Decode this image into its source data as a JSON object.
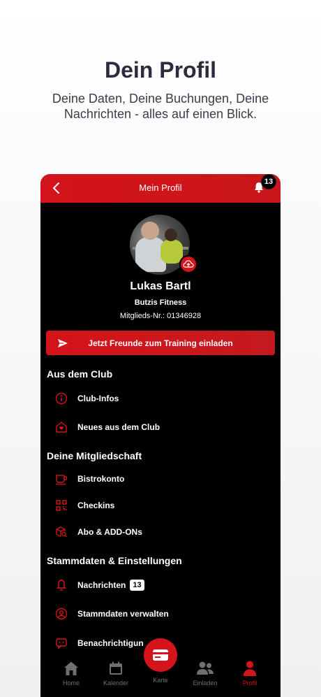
{
  "promo": {
    "title": "Dein Profil",
    "subtitle": "Deine Daten, Deine Buchungen, Deine Nachrichten - alles auf einen Blick."
  },
  "header": {
    "title": "Mein Profil",
    "notification_count": "13"
  },
  "profile": {
    "name": "Lukas Bartl",
    "club": "Butzis Fitness",
    "member_number": "Mitglieds-Nr.: 01346928"
  },
  "invite_button": "Jetzt Freunde zum Training einladen",
  "sections": {
    "club": {
      "title": "Aus dem Club",
      "items": [
        {
          "label": "Club-Infos",
          "icon": "info-icon"
        },
        {
          "label": "Neues aus dem Club",
          "icon": "house-heart-icon"
        }
      ]
    },
    "membership": {
      "title": "Deine Mitgliedschaft",
      "items": [
        {
          "label": "Bistrokonto",
          "icon": "cup-icon"
        },
        {
          "label": "Checkins",
          "icon": "qr-code-icon"
        },
        {
          "label": "Abo & ADD-ONs",
          "icon": "box-search-icon"
        }
      ]
    },
    "settings": {
      "title": "Stammdaten & Einstellungen",
      "items": [
        {
          "label": "Nachrichten",
          "icon": "bell-icon",
          "count": "13"
        },
        {
          "label": "Stammdaten verwalten",
          "icon": "user-circle-icon"
        },
        {
          "label": "Benachrichtigun",
          "icon": "message-icon"
        }
      ]
    }
  },
  "tabbar": {
    "home": "Home",
    "calendar": "Kalender",
    "card": "Karte",
    "invite": "Einladen",
    "profile": "Profil"
  },
  "colors": {
    "accent": "#d4141a",
    "background": "#000000",
    "inactive": "#6f6f6f"
  }
}
